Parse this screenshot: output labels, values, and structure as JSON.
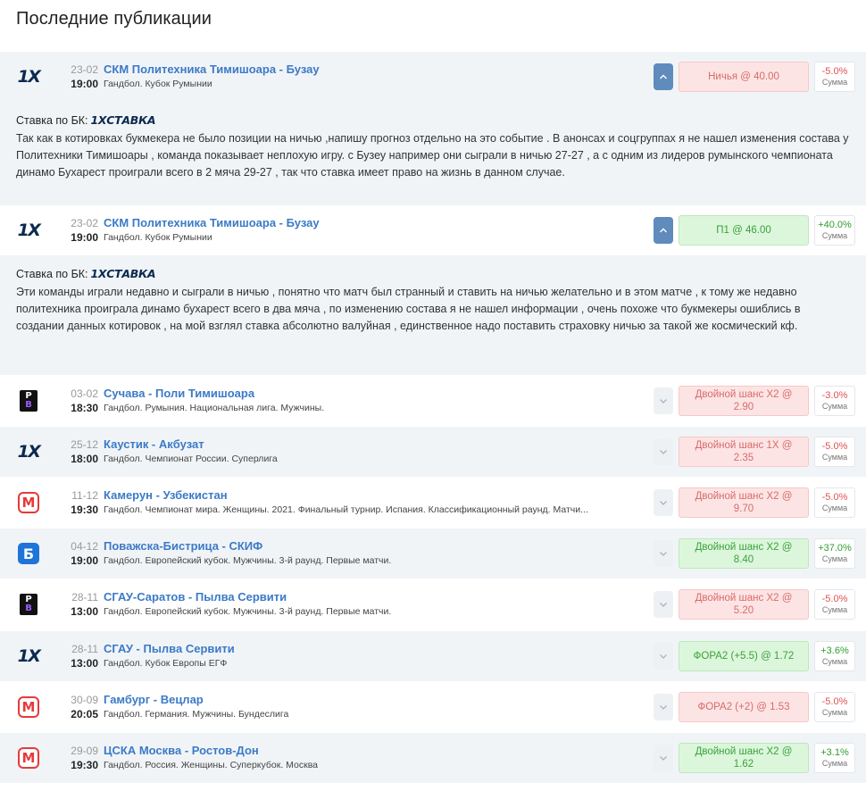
{
  "page_title": "Последние публикации",
  "bk_prefix": "Ставка по БК:",
  "bk_name": "1XСТАВКА",
  "sum_label": "Сумма",
  "rows": [
    {
      "logo": "1x-logo",
      "date": "23-02",
      "time": "19:00",
      "teams": "СКМ Политехника Тимишоара - Бузау",
      "league": "Гандбол. Кубок Румынии",
      "bet": "Ничья @ 40.00",
      "result": "-5.0%",
      "status": "lose",
      "expanded": true
    },
    {
      "logo": "1x-logo",
      "date": "23-02",
      "time": "19:00",
      "teams": "СКМ Политехника Тимишоара - Бузау",
      "league": "Гандбол. Кубок Румынии",
      "bet": "П1 @ 46.00",
      "result": "+40.0%",
      "status": "win",
      "expanded": true
    },
    {
      "logo": "pb-logo",
      "date": "03-02",
      "time": "18:30",
      "teams": "Сучава - Поли Тимишоара",
      "league": "Гандбол. Румыния. Национальная лига. Мужчины.",
      "bet": "Двойной шанс X2 @ 2.90",
      "result": "-3.0%",
      "status": "lose",
      "expanded": false
    },
    {
      "logo": "1x-logo",
      "date": "25-12",
      "time": "18:00",
      "teams": "Каустик - Акбузат",
      "league": "Гандбол. Чемпионат России. Суперлига",
      "bet": "Двойной шанс 1X @ 2.35",
      "result": "-5.0%",
      "status": "lose",
      "expanded": false
    },
    {
      "logo": "m-logo",
      "date": "11-12",
      "time": "19:30",
      "teams": "Камерун - Узбекистан",
      "league": "Гандбол. Чемпионат мира. Женщины. 2021. Финальный турнир. Испания. Классификационный раунд. Матчи...",
      "bet": "Двойной шанс X2 @ 9.70",
      "result": "-5.0%",
      "status": "lose",
      "expanded": false
    },
    {
      "logo": "b-logo",
      "date": "04-12",
      "time": "19:00",
      "teams": "Поважска-Бистрица - СКИФ",
      "league": "Гандбол. Европейский кубок. Мужчины. 3-й раунд. Первые матчи.",
      "bet": "Двойной шанс X2 @ 8.40",
      "result": "+37.0%",
      "status": "win",
      "expanded": false
    },
    {
      "logo": "pb-logo",
      "date": "28-11",
      "time": "13:00",
      "teams": "СГАУ-Саратов - Пылва Сервити",
      "league": "Гандбол. Европейский кубок. Мужчины. 3-й раунд. Первые матчи.",
      "bet": "Двойной шанс X2 @ 5.20",
      "result": "-5.0%",
      "status": "lose",
      "expanded": false
    },
    {
      "logo": "1x-logo",
      "date": "28-11",
      "time": "13:00",
      "teams": "СГАУ - Пылва Сервити",
      "league": "Гандбол. Кубок Европы ЕГФ",
      "bet": "ФОРА2 (+5.5) @ 1.72",
      "result": "+3.6%",
      "status": "win",
      "expanded": false
    },
    {
      "logo": "m-logo",
      "date": "30-09",
      "time": "20:05",
      "teams": "Гамбург - Вецлар",
      "league": "Гандбол. Германия. Мужчины. Бундеслига",
      "bet": "ФОРА2 (+2) @ 1.53",
      "result": "-5.0%",
      "status": "lose",
      "expanded": false
    },
    {
      "logo": "m-logo",
      "date": "29-09",
      "time": "19:30",
      "teams": "ЦСКА Москва - Ростов-Дон",
      "league": "Гандбол. Россия. Женщины. Суперкубок. Москва",
      "bet": "Двойной шанс X2 @ 1.62",
      "result": "+3.1%",
      "status": "win",
      "expanded": false
    }
  ],
  "comments": [
    "Так как в котировках букмекера не было позиции на ничью ,напишу прогноз отдельно на это событие . В анонсах и соцгруппах я не нашел изменения состава у Политехники Тимишоары , команда показывает неплохую игру. с Бузеу например они сыграли в ничью 27-27 , а с одним из лидеров румынского чемпионата динамо Бухарест проиграли всего в 2 мяча 29-27 , так что ставка имеет право на жизнь в данном случае.",
    "Эти команды играли недавно и сыграли в ничью , понятно что матч был странный и ставить на ничью желательно и в этом матче , к тому же недавно политехника проиграла динамо бухарест всего в два мяча , по изменению состава я не нашел информации , очень похоже что букмекеры ошиблись в создании данных котировок , на мой взглял ставка абсолютно валуйная , единственное надо поставить страховку ничью за такой же космический кф."
  ],
  "colors": {
    "link": "#3b7ac7",
    "lose_bg": "#fde4e4",
    "lose_text": "#d76b6b",
    "win_bg": "#dcf6dc",
    "win_text": "#3aa23a",
    "row_shade": "#f1f4f7"
  }
}
